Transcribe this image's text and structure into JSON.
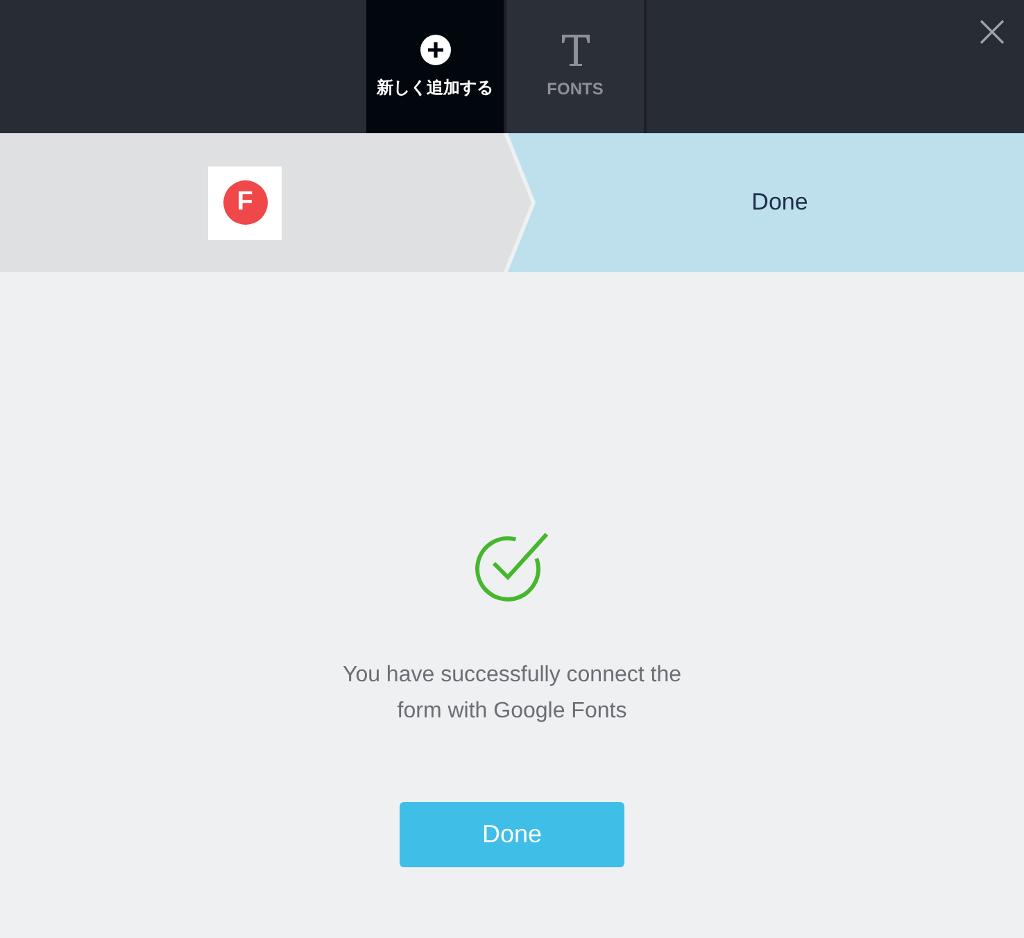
{
  "tabs": [
    {
      "label": "新しく追加する",
      "kind": "plus",
      "selected": true
    },
    {
      "label": "FONTS",
      "kind": "text",
      "selected": false
    }
  ],
  "steps": [
    {
      "kind": "logo",
      "logo_letter": "F",
      "selected": false
    },
    {
      "kind": "text",
      "label": "Done",
      "selected": true
    }
  ],
  "message": {
    "text": "You have successfully connect the form with Google Fonts"
  },
  "done_button": {
    "label": "Done"
  }
}
